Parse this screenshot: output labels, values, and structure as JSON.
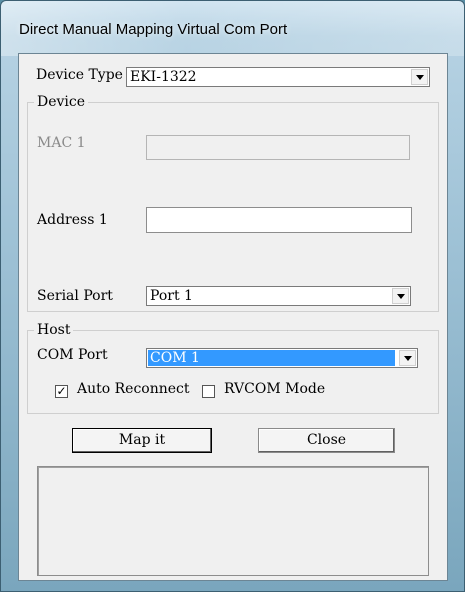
{
  "window": {
    "title": "Direct Manual Mapping Virtual Com Port"
  },
  "device_type": {
    "label": "Device Type",
    "value": "EKI-1322"
  },
  "device_group": {
    "title": "Device",
    "mac_label": "MAC 1",
    "mac_value": "",
    "address_label": "Address 1",
    "address_value": "",
    "serial_label": "Serial Port",
    "serial_value": "Port 1"
  },
  "host_group": {
    "title": "Host",
    "com_label": "COM Port",
    "com_value": "COM 1",
    "auto_reconnect_label": "Auto Reconnect",
    "auto_reconnect_checked": true,
    "rvcom_label": "RVCOM Mode",
    "rvcom_checked": false
  },
  "buttons": {
    "map_label": "Map it",
    "close_label": "Close"
  },
  "icons": {
    "dropdown": "chevron-down-icon",
    "check": "checkmark-icon"
  }
}
